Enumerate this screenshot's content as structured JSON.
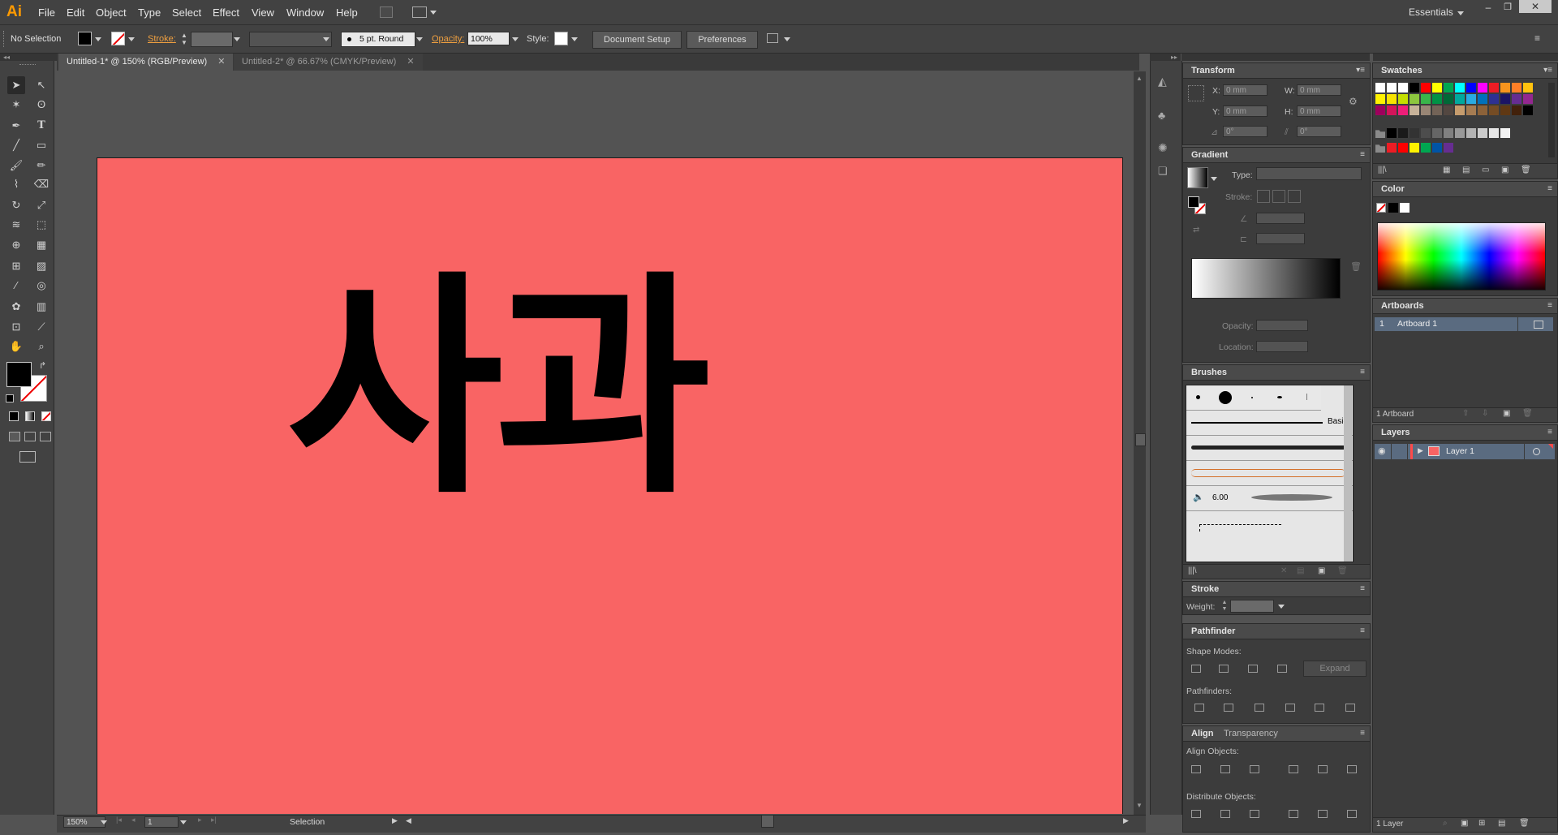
{
  "app": {
    "logo": "Ai",
    "workspace": "Essentials",
    "menu": [
      "File",
      "Edit",
      "Object",
      "Type",
      "Select",
      "Effect",
      "View",
      "Window",
      "Help"
    ]
  },
  "control_bar": {
    "selection_state": "No Selection",
    "stroke_label": "Stroke:",
    "brush_value": "5 pt. Round",
    "opacity_label": "Opacity:",
    "opacity_value": "100%",
    "style_label": "Style:",
    "document_setup": "Document Setup",
    "preferences": "Preferences"
  },
  "tabs": [
    {
      "label": "Untitled-1* @ 150% (RGB/Preview)",
      "active": true
    },
    {
      "label": "Untitled-2* @ 66.67% (CMYK/Preview)",
      "active": false
    }
  ],
  "artboard": {
    "text": "사과",
    "background": "#f96464",
    "text_color": "#000000"
  },
  "status": {
    "zoom": "150%",
    "artboard_number": "1",
    "tool": "Selection"
  },
  "transform": {
    "title": "Transform",
    "x_label": "X:",
    "x_value": "0 mm",
    "y_label": "Y:",
    "y_value": "0 mm",
    "w_label": "W:",
    "w_value": "0 mm",
    "h_label": "H:",
    "h_value": "0 mm",
    "angle_value": "0°",
    "shear_value": "0°"
  },
  "gradient": {
    "title": "Gradient",
    "type_label": "Type:",
    "stroke_label": "Stroke:",
    "opacity_label": "Opacity:",
    "location_label": "Location:"
  },
  "brushes": {
    "title": "Brushes",
    "basic_label": "Basic",
    "size_value": "6.00"
  },
  "stroke": {
    "title": "Stroke",
    "weight_label": "Weight:"
  },
  "pathfinder": {
    "title": "Pathfinder",
    "shape_modes_label": "Shape Modes:",
    "expand_label": "Expand",
    "pathfinders_label": "Pathfinders:"
  },
  "align": {
    "title": "Align",
    "tab2": "Transparency",
    "align_objects_label": "Align Objects:",
    "distribute_objects_label": "Distribute Objects:"
  },
  "swatches": {
    "title": "Swatches",
    "row1": [
      "#ffffff",
      "#ffffff",
      "#ffffff",
      "#000000",
      "#ff0000",
      "#ffff00",
      "#00a651",
      "#00ffff",
      "#0000ff",
      "#ff00ff",
      "#ed1c24",
      "#f7941d",
      "#ff7f27",
      "#ffc20e"
    ],
    "row2": [
      "#fff200",
      "#f7e300",
      "#c4df00",
      "#8dc63f",
      "#39b54a",
      "#009245",
      "#006837",
      "#00a99d",
      "#29abe2",
      "#0071bc",
      "#2e3192",
      "#1b1464",
      "#662d91",
      "#93278f"
    ],
    "row3": [
      "#9e005d",
      "#d4145a",
      "#ed1e79",
      "#c7b299",
      "#998675",
      "#736357",
      "#534741",
      "#c69c6d",
      "#a67c52",
      "#8c6239",
      "#754c24",
      "#603813",
      "#42210b",
      "#000000"
    ],
    "gray_row": [
      "#000000",
      "#1a1a1a",
      "#333333",
      "#4d4d4d",
      "#666666",
      "#808080",
      "#999999",
      "#b3b3b3",
      "#cccccc",
      "#e6e6e6",
      "#f2f2f2"
    ],
    "color_group": [
      "#ed1c24",
      "#ff0000",
      "#fff200",
      "#00a651",
      "#0054a6",
      "#662d91"
    ]
  },
  "color": {
    "title": "Color"
  },
  "artboards": {
    "title": "Artboards",
    "items": [
      {
        "number": "1",
        "name": "Artboard 1"
      }
    ],
    "count_label": "1 Artboard"
  },
  "layers": {
    "title": "Layers",
    "items": [
      {
        "name": "Layer 1",
        "color": "#ff4a4a"
      }
    ],
    "count_label": "1 Layer"
  },
  "icons": {
    "menu": "hamburger-icon",
    "close": "close-icon",
    "minimize": "minimize-icon",
    "restore": "restore-icon"
  }
}
